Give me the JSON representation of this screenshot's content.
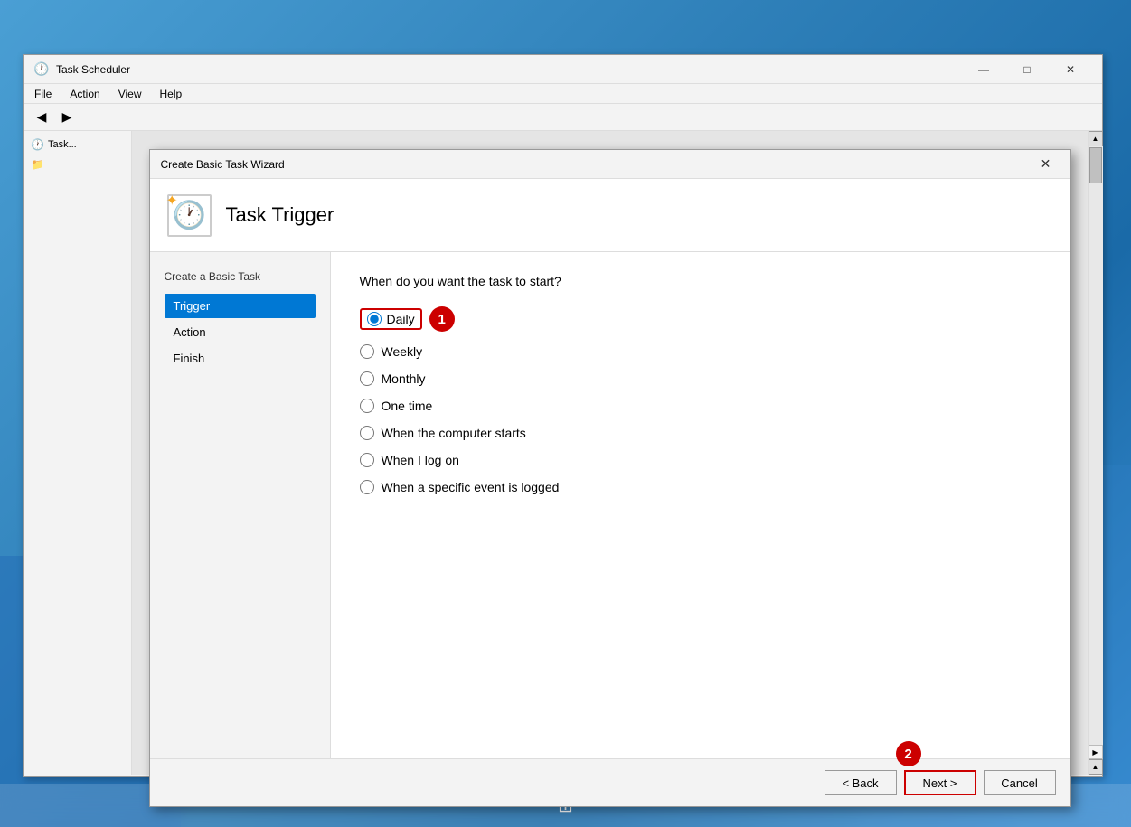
{
  "window": {
    "title": "Task Scheduler",
    "icon": "🕐",
    "controls": {
      "minimize": "—",
      "maximize": "□",
      "close": "✕"
    }
  },
  "menu": {
    "items": [
      "File",
      "Action",
      "View",
      "Help"
    ]
  },
  "dialog": {
    "title": "Create Basic Task Wizard",
    "close": "✕",
    "header": {
      "title": "Task Trigger",
      "icon": "🕐",
      "star": "✦"
    },
    "wizard_nav": {
      "section_label": "Create a Basic Task",
      "items": [
        "Trigger",
        "Action",
        "Finish"
      ]
    },
    "content": {
      "question": "When do you want the task to start?",
      "options": [
        {
          "id": "daily",
          "label": "Daily",
          "checked": true
        },
        {
          "id": "weekly",
          "label": "Weekly",
          "checked": false
        },
        {
          "id": "monthly",
          "label": "Monthly",
          "checked": false
        },
        {
          "id": "one_time",
          "label": "One time",
          "checked": false
        },
        {
          "id": "computer_starts",
          "label": "When the computer starts",
          "checked": false
        },
        {
          "id": "log_on",
          "label": "When I log on",
          "checked": false
        },
        {
          "id": "event_logged",
          "label": "When a specific event is logged",
          "checked": false
        }
      ]
    },
    "footer": {
      "back_label": "< Back",
      "next_label": "Next >",
      "cancel_label": "Cancel"
    },
    "badges": {
      "step1": "1",
      "step2": "2"
    }
  }
}
